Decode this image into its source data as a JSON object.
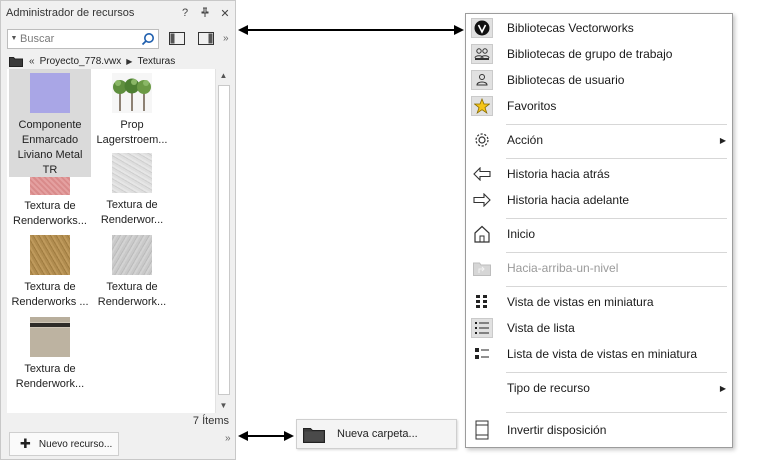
{
  "palette": {
    "title": "Administrador de recursos",
    "help_btn": "?",
    "pin_btn": "⊥",
    "close_btn": "✕",
    "more_chevron": "»",
    "search_placeholder": "Buscar",
    "path": {
      "prefix": "«",
      "file": "Proyecto_778.vwx",
      "separator": "▶",
      "folder": "Texturas"
    },
    "items": [
      {
        "label_lines": [
          "Componente",
          "Enmarcado",
          "Liviano Metal",
          "TR"
        ],
        "thumb": "purple-swatch",
        "selected": true
      },
      {
        "label_lines": [
          "Prop",
          "Lagerstroem..."
        ],
        "thumb": "plant-image",
        "selected": false
      },
      {
        "label_lines": [
          "Textura de",
          "Renderworks..."
        ],
        "thumb": "pink-texture",
        "selected": false
      },
      {
        "label_lines": [
          "Textura de",
          "Renderwor..."
        ],
        "thumb": "light-gray-texture",
        "selected": false
      },
      {
        "label_lines": [
          "Textura de",
          "Renderworks ..."
        ],
        "thumb": "brown-texture",
        "selected": false
      },
      {
        "label_lines": [
          "Textura de",
          "Renderwork..."
        ],
        "thumb": "gray-texture",
        "selected": false
      },
      {
        "label_lines": [
          "Textura de",
          "Renderwork..."
        ],
        "thumb": "striped-texture",
        "selected": false
      }
    ],
    "items_count": "7 Ítems",
    "new_resource_button": "Nuevo recurso...",
    "bottom_chevron": "»",
    "scroll_up": "▲",
    "scroll_down": "▼"
  },
  "new_folder_popup": {
    "label": "Nueva carpeta..."
  },
  "menu": {
    "items": [
      {
        "label": "Bibliotecas Vectorworks",
        "icon": "vectorworks-logo-icon",
        "boxed": true
      },
      {
        "label": "Bibliotecas de grupo de trabajo",
        "icon": "workgroup-icon",
        "boxed": true
      },
      {
        "label": "Bibliotecas de usuario",
        "icon": "user-icon",
        "boxed": true
      },
      {
        "label": "Favoritos",
        "icon": "star-icon",
        "boxed": true
      },
      {
        "label": "Acción",
        "icon": "gear-icon",
        "submenu": true
      },
      {
        "label": "Historia hacia atrás",
        "icon": "arrow-left-icon"
      },
      {
        "label": "Historia hacia adelante",
        "icon": "arrow-right-icon"
      },
      {
        "label": "Inicio",
        "icon": "home-icon"
      },
      {
        "label": "Hacia-arriba-un-nivel",
        "icon": "folder-up-icon",
        "disabled": true
      },
      {
        "label": "Vista de vistas en miniatura",
        "icon": "thumbnail-grid-icon"
      },
      {
        "label": "Vista de lista",
        "icon": "list-view-icon",
        "boxed": true
      },
      {
        "label": "Lista de vista de vistas en miniatura",
        "icon": "thumbnail-list-icon"
      },
      {
        "label": "Tipo de recurso",
        "icon": "",
        "submenu": true
      },
      {
        "label": "Invertir disposición",
        "icon": "flip-layout-icon"
      }
    ],
    "submenu_arrow": "▶"
  },
  "colors": {
    "accent_star": "#f5c518",
    "selection_bg": "#dadada",
    "purple_swatch": "#a9a6e6"
  }
}
